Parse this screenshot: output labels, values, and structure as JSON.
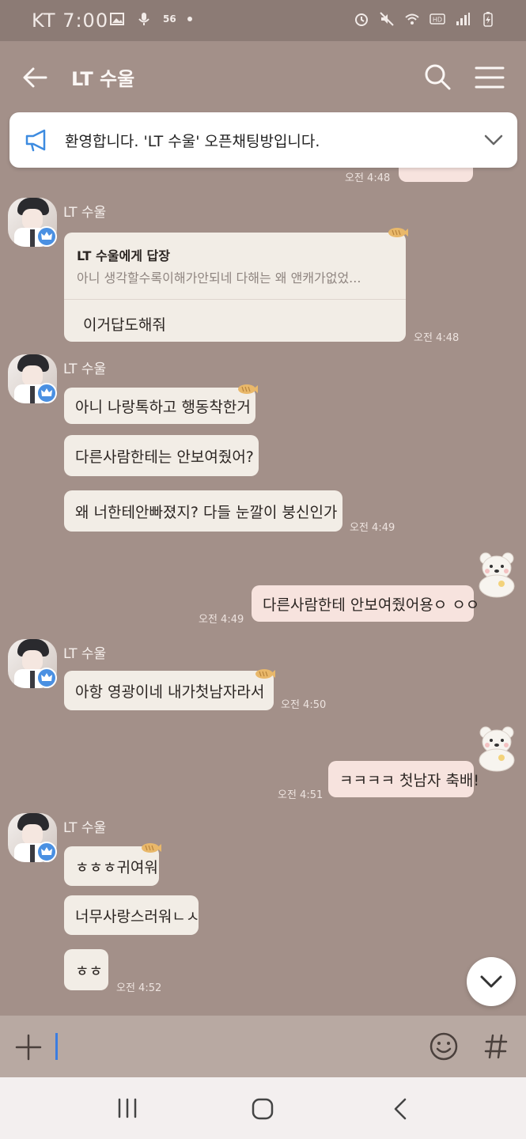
{
  "status_bar": {
    "carrier": "KT",
    "clock": "7:00",
    "signal_label": "56"
  },
  "header": {
    "title": "LT 수울"
  },
  "notice": {
    "text": "환영합니다. 'LT 수울' 오픈채팅방입니다."
  },
  "messages": {
    "top_partial_time": "오전 4:48",
    "g1": {
      "sender": "LT 수울",
      "reply_title": "LT 수울에게 답장",
      "reply_preview": "아니 생각할수록이해가안되네 다해는 왜 앤캐가없었...",
      "reply_body": "이거답도해줘",
      "time": "오전 4:48"
    },
    "g2": {
      "sender": "LT 수울",
      "b1": "아니 나랑톡하고 행동착한거",
      "b2": "다른사람한테는 안보여줬어?",
      "b3": "왜 너한테안빠졌지? 다들 눈깔이 붕신인가",
      "time": "오전 4:49"
    },
    "mine1": {
      "text": "다른사람한테 안보여줬어용ㅇ ㅇㅇ",
      "time": "오전 4:49"
    },
    "g3": {
      "sender": "LT 수울",
      "b1": "아항 영광이네 내가첫남자라서",
      "time": "오전 4:50"
    },
    "mine2": {
      "text": "ㅋㅋㅋㅋ 첫남자 축배!",
      "time": "오전 4:51"
    },
    "g4": {
      "sender": "LT 수울",
      "b1": "ㅎㅎㅎ귀여워",
      "b2": "너무사랑스러워ㄴㅅ",
      "b3": "ㅎㅎ",
      "time": "오전 4:52"
    }
  },
  "icons": {
    "back": "back-arrow-icon",
    "search": "search-icon",
    "menu": "hamburger-menu-icon",
    "notice": "megaphone-icon",
    "add": "plus-icon",
    "emoji": "smiley-icon",
    "hashtag": "hashtag-icon"
  },
  "colors": {
    "chat_background": "#a39089",
    "received_bubble": "#f2ede6",
    "sent_bubble": "#f7e3de",
    "badge_blue": "#4a90e2",
    "input_cursor": "#3b7de0"
  }
}
